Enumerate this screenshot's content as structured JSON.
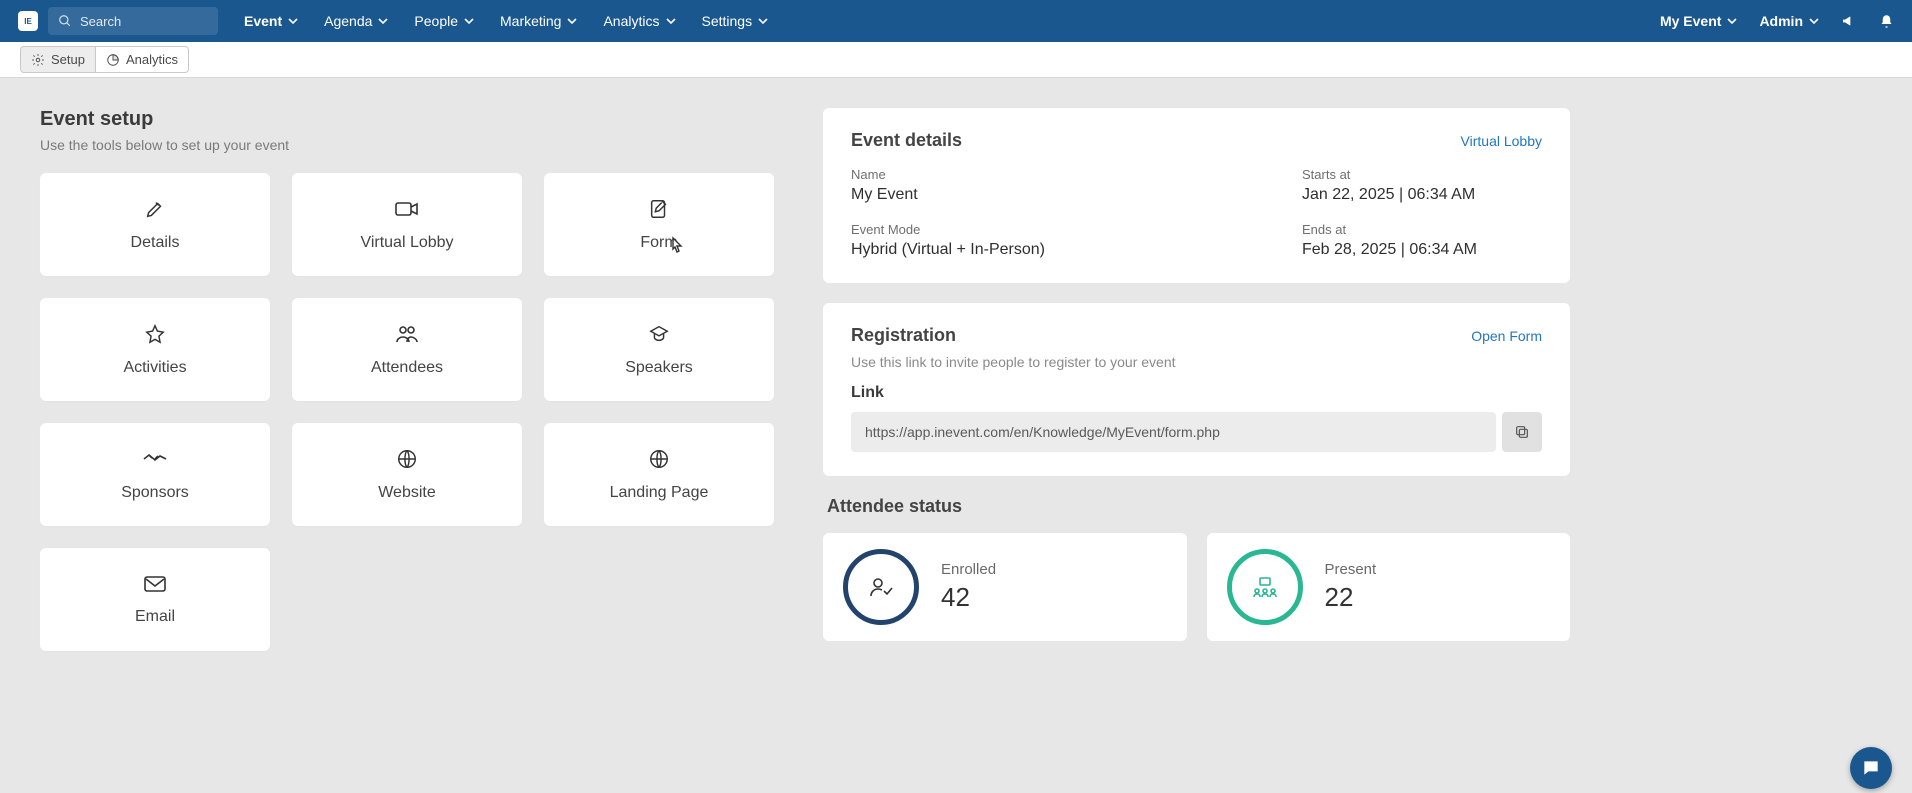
{
  "nav": {
    "search_placeholder": "Search",
    "items": [
      {
        "label": "Event",
        "bold": true
      },
      {
        "label": "Agenda",
        "bold": false
      },
      {
        "label": "People",
        "bold": false
      },
      {
        "label": "Marketing",
        "bold": false
      },
      {
        "label": "Analytics",
        "bold": false
      },
      {
        "label": "Settings",
        "bold": false
      }
    ],
    "event_switcher": "My Event",
    "user": "Admin"
  },
  "subbar": {
    "setup": "Setup",
    "analytics": "Analytics"
  },
  "setup": {
    "title": "Event setup",
    "subtitle": "Use the tools below to set up your event",
    "tiles": [
      {
        "label": "Details",
        "icon": "pencil-icon"
      },
      {
        "label": "Virtual Lobby",
        "icon": "video-icon"
      },
      {
        "label": "Form",
        "icon": "form-icon"
      },
      {
        "label": "Activities",
        "icon": "star-icon"
      },
      {
        "label": "Attendees",
        "icon": "people-icon"
      },
      {
        "label": "Speakers",
        "icon": "speaker-icon"
      },
      {
        "label": "Sponsors",
        "icon": "handshake-icon"
      },
      {
        "label": "Website",
        "icon": "globe-icon"
      },
      {
        "label": "Landing Page",
        "icon": "globe-icon"
      },
      {
        "label": "Email",
        "icon": "mail-icon"
      }
    ]
  },
  "details": {
    "card_title": "Event details",
    "lobby_link": "Virtual Lobby",
    "name_k": "Name",
    "name_v": "My Event",
    "mode_k": "Event Mode",
    "mode_v": "Hybrid (Virtual + In-Person)",
    "start_k": "Starts at",
    "start_v": "Jan 22, 2025 | 06:34 AM",
    "end_k": "Ends at",
    "end_v": "Feb 28, 2025 | 06:34 AM"
  },
  "registration": {
    "card_title": "Registration",
    "open_link": "Open Form",
    "hint": "Use this link to invite people to register to your event",
    "link_label": "Link",
    "url": "https://app.inevent.com/en/Knowledge/MyEvent/form.php"
  },
  "attendees": {
    "title": "Attendee status",
    "enrolled_k": "Enrolled",
    "enrolled_v": "42",
    "present_k": "Present",
    "present_v": "22"
  }
}
